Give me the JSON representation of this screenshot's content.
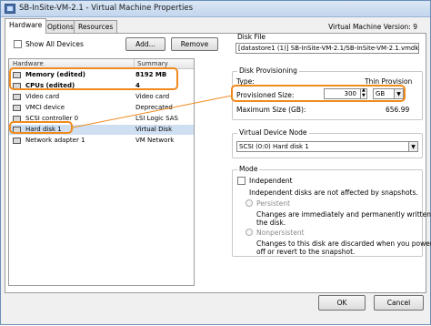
{
  "window": {
    "title": "SB-InSite-VM-2.1 - Virtual Machine Properties"
  },
  "tabs": [
    {
      "label": "Hardware",
      "active": true
    },
    {
      "label": "Options",
      "active": false
    },
    {
      "label": "Resources",
      "active": false
    }
  ],
  "vm_version_label": "Virtual Machine Version: 9",
  "hardware_panel": {
    "show_all_devices_label": "Show All Devices",
    "show_all_devices_checked": false,
    "add_button": "Add...",
    "remove_button": "Remove",
    "columns": [
      "Hardware",
      "Summary"
    ],
    "rows": [
      {
        "name": "Memory (edited)",
        "summary": "8192 MB",
        "bold": true,
        "icon": "memory-icon"
      },
      {
        "name": "CPUs (edited)",
        "summary": "4",
        "bold": true,
        "icon": "cpu-icon"
      },
      {
        "name": "Video card",
        "summary": "Video card",
        "bold": false,
        "icon": "video-card-icon"
      },
      {
        "name": "VMCI device",
        "summary": "Deprecated",
        "bold": false,
        "icon": "vmci-device-icon"
      },
      {
        "name": "SCSI controller 0",
        "summary": "LSI Logic SAS",
        "bold": false,
        "icon": "scsi-controller-icon"
      },
      {
        "name": "Hard disk 1",
        "summary": "Virtual Disk",
        "bold": false,
        "icon": "hard-disk-icon",
        "selected": true
      },
      {
        "name": "Network adapter 1",
        "summary": "VM Network",
        "bold": false,
        "icon": "network-adapter-icon"
      }
    ]
  },
  "disk_file": {
    "title": "Disk File",
    "value": "[datastore1 (1)] SB-InSite-VM-2.1/SB-InSite-VM-2.1.vmdk"
  },
  "disk_provisioning": {
    "title": "Disk Provisioning",
    "type_label": "Type:",
    "type_value": "Thin Provision",
    "provisioned_size_label": "Provisioned Size:",
    "provisioned_size_value": "300",
    "unit": "GB",
    "max_size_label": "Maximum Size (GB):",
    "max_size_value": "656.99"
  },
  "virtual_device_node": {
    "title": "Virtual Device Node",
    "value": "SCSI (0:0) Hard disk 1"
  },
  "mode": {
    "title": "Mode",
    "independent_label": "Independent",
    "independent_checked": false,
    "independent_desc": "Independent disks are not affected by snapshots.",
    "persistent_label": "Persistent",
    "persistent_desc_1": "Changes are immediately and permanently written to",
    "persistent_desc_2": "the disk.",
    "nonpersistent_label": "Nonpersistent",
    "nonpersistent_desc_1": "Changes to this disk are discarded when you power",
    "nonpersistent_desc_2": "off or revert to the snapshot."
  },
  "footer": {
    "ok_button": "OK",
    "cancel_button": "Cancel"
  },
  "colors": {
    "highlight": "#f08a1c",
    "selected_row": "#cfdff2",
    "title_bar": "#c2d6ee"
  }
}
